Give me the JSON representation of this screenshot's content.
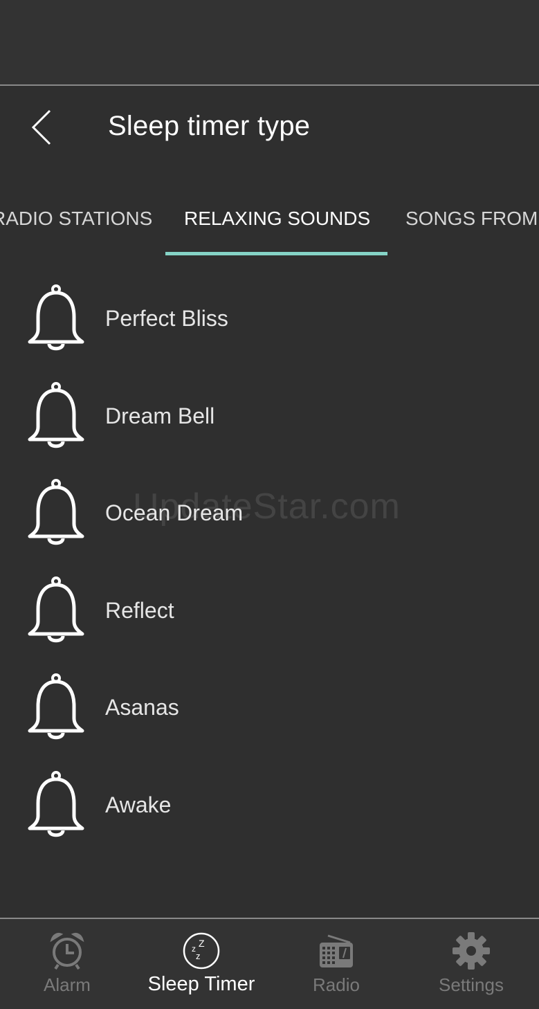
{
  "header": {
    "title": "Sleep timer type"
  },
  "tabs": [
    {
      "label": "RADIO STATIONS"
    },
    {
      "label": "RELAXING SOUNDS"
    },
    {
      "label": "SONGS FROM"
    }
  ],
  "sounds": [
    {
      "label": "Perfect Bliss",
      "icon": "bell-icon"
    },
    {
      "label": "Dream Bell",
      "icon": "bell-icon"
    },
    {
      "label": "Ocean Dream",
      "icon": "bell-icon"
    },
    {
      "label": "Reflect",
      "icon": "bell-icon"
    },
    {
      "label": "Asanas",
      "icon": "bell-icon"
    },
    {
      "label": "Awake",
      "icon": "bell-icon"
    }
  ],
  "watermark": "UpdateStar.com",
  "bottom_nav": [
    {
      "label": "Alarm",
      "icon": "alarm-clock-icon"
    },
    {
      "label": "Sleep Timer",
      "icon": "sleep-zzz-icon"
    },
    {
      "label": "Radio",
      "icon": "radio-icon"
    },
    {
      "label": "Settings",
      "icon": "gear-icon"
    }
  ],
  "colors": {
    "background": "#2f2f2f",
    "tab_indicator": "#86d4c7",
    "inactive_nav": "#7a7a7a",
    "active_text": "#ffffff"
  }
}
